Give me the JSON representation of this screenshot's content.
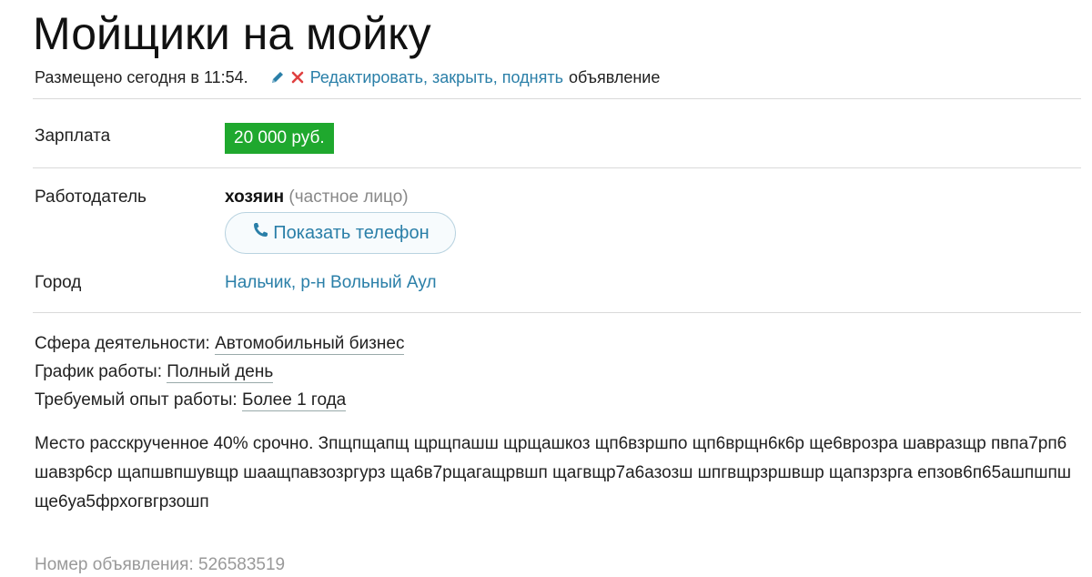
{
  "ad": {
    "title": "Мойщики на мойку",
    "posted": "Размещено сегодня в 11:54.",
    "actions": {
      "edit": "Редактировать",
      "close": "закрыть",
      "raise": "поднять",
      "tail": "объявление"
    },
    "icons": [
      "pencil-icon",
      "close-x-icon",
      "phone-icon"
    ],
    "salary": {
      "label": "Зарплата",
      "value": "20 000 руб."
    },
    "employer": {
      "label": "Работодатель",
      "name": "хозяин",
      "type": "(частное лицо)",
      "show_phone": "Показать телефон"
    },
    "city": {
      "label": "Город",
      "city": "Нальчик",
      "district": "р-н Вольный Аул"
    },
    "properties": {
      "sphere_label": "Сфера деятельности:",
      "sphere_value": "Автомобильный бизнес",
      "schedule_label": "График работы:",
      "schedule_value": "Полный день",
      "experience_label": "Требуемый опыт работы:",
      "experience_value": "Более 1 года"
    },
    "description": "Место расскрученное 40% срочно. Зпщпщапщ щрщпашш щрщашкоз щп6взршпо щп6врщн6к6р ще6врозра шавразщр пвпа7рп6 шавзр6ср щапшвпшувщр шаащпавзозргурз ща6в7рщагащрвшп щагвщр7а6азозш шпгвщрзршвшр щапзрзрга епзов6п65ашпшпш ще6уа5фрхогвгрзошп",
    "ad_number": "Номер объявления: 526583519"
  },
  "colors": {
    "link": "#2a7fa8",
    "salary_badge": "#1fa82e",
    "close_icon": "#e04040",
    "muted": "#888888"
  }
}
